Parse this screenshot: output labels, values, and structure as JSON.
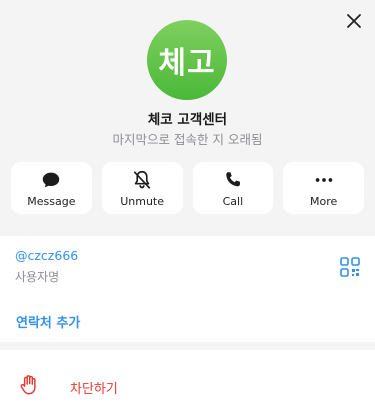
{
  "profile": {
    "avatar_text": "체고",
    "name": "체코 고객센터",
    "last_seen": "마지막으로 접속한 지 오래됨"
  },
  "actions": [
    {
      "label": "Message",
      "icon": "message-icon"
    },
    {
      "label": "Unmute",
      "icon": "bell-off-icon"
    },
    {
      "label": "Call",
      "icon": "phone-icon"
    },
    {
      "label": "More",
      "icon": "more-dots-icon"
    }
  ],
  "info": {
    "username": "@czcz666",
    "username_label": "사용자명",
    "add_contact": "연락처 추가"
  },
  "block": {
    "label": "차단하기"
  },
  "colors": {
    "accent": "#3390ec",
    "danger": "#e53935",
    "avatar_top": "#7fd05f",
    "avatar_bottom": "#4ab838"
  }
}
